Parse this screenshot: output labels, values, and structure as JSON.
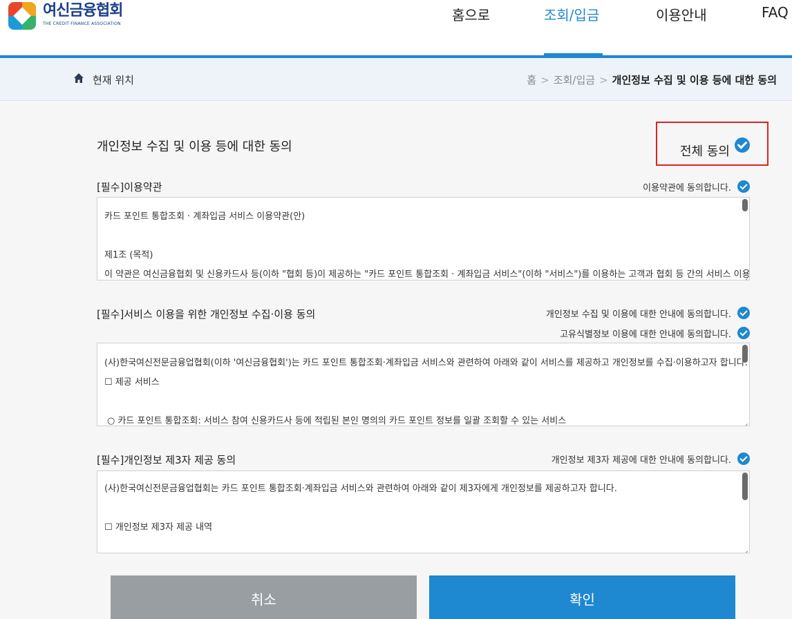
{
  "header": {
    "logo_title": "여신금융협회",
    "logo_sub": "THE CREDIT FINANCE ASSOCIATION",
    "nav": [
      "홈으로",
      "조회/입금",
      "이용안내",
      "FAQ"
    ],
    "active_nav": "조회/입금"
  },
  "breadcrumb": {
    "label": "현재 위치",
    "items": [
      "홈",
      "조회/입금",
      "개인정보 수집 및 이용 등에 대한 동의"
    ],
    "separator": ">"
  },
  "main": {
    "title": "개인정보 수집 및 이용 등에 대한 동의",
    "all_agree": "전체 동의"
  },
  "sections": [
    {
      "title": "[필수]이용약관",
      "agrees": [
        "이용약관에 동의합니다."
      ],
      "lines": [
        "카드 포인트 통합조회 · 계좌입금 서비스 이용약관(안)",
        "",
        "제1조 (목적)",
        "이 약관은 여신금융협회 및 신용카드사 등(이하 \"협회 등)이 제공하는 \"카드 포인트 통합조회 · 계좌입금 서비스\"(이하 \"서비스\")를 이용하는 고객과 협회 등 간의 서비스 이용에"
      ]
    },
    {
      "title": "[필수]서비스 이용을 위한 개인정보 수집·이용 동의",
      "agrees": [
        "개인정보 수집 및 이용에 대한 안내에 동의합니다.",
        "고유식별정보 이용에 대한 안내에 동의합니다."
      ],
      "lines": [
        "(사)한국여신전문금융업협회(이하 '여신금융협회')는 카드 포인트 통합조회·계좌입금 서비스와 관련하여 아래와 같이 서비스를 제공하고 개인정보를 수집·이용하고자 합니다.",
        "☐ 제공 서비스",
        "",
        "  ○ 카드 포인트 통합조회: 서비스 참여 신용카드사 등에 적립된 본인 명의의 카드 포인트 정보를 일괄 조회할 수 있는 서비스"
      ]
    },
    {
      "title": "[필수]개인정보 제3자 제공 동의",
      "agrees": [
        "개인정보 제3자 제공에 대한 안내에 동의합니다."
      ],
      "lines": [
        "(사)한국여신전문금융업협회는 카드 포인트 통합조회·계좌입금 서비스와 관련하여 아래와 같이 제3자에게 개인정보를 제공하고자 합니다.",
        "",
        "☐ 개인정보 제3자 제공 내역"
      ]
    }
  ],
  "buttons": {
    "cancel": "취소",
    "confirm": "확인"
  },
  "colors": {
    "accent": "#1e88d0",
    "highlight_box": "#e02020",
    "cancel_button": "#999ea2"
  }
}
